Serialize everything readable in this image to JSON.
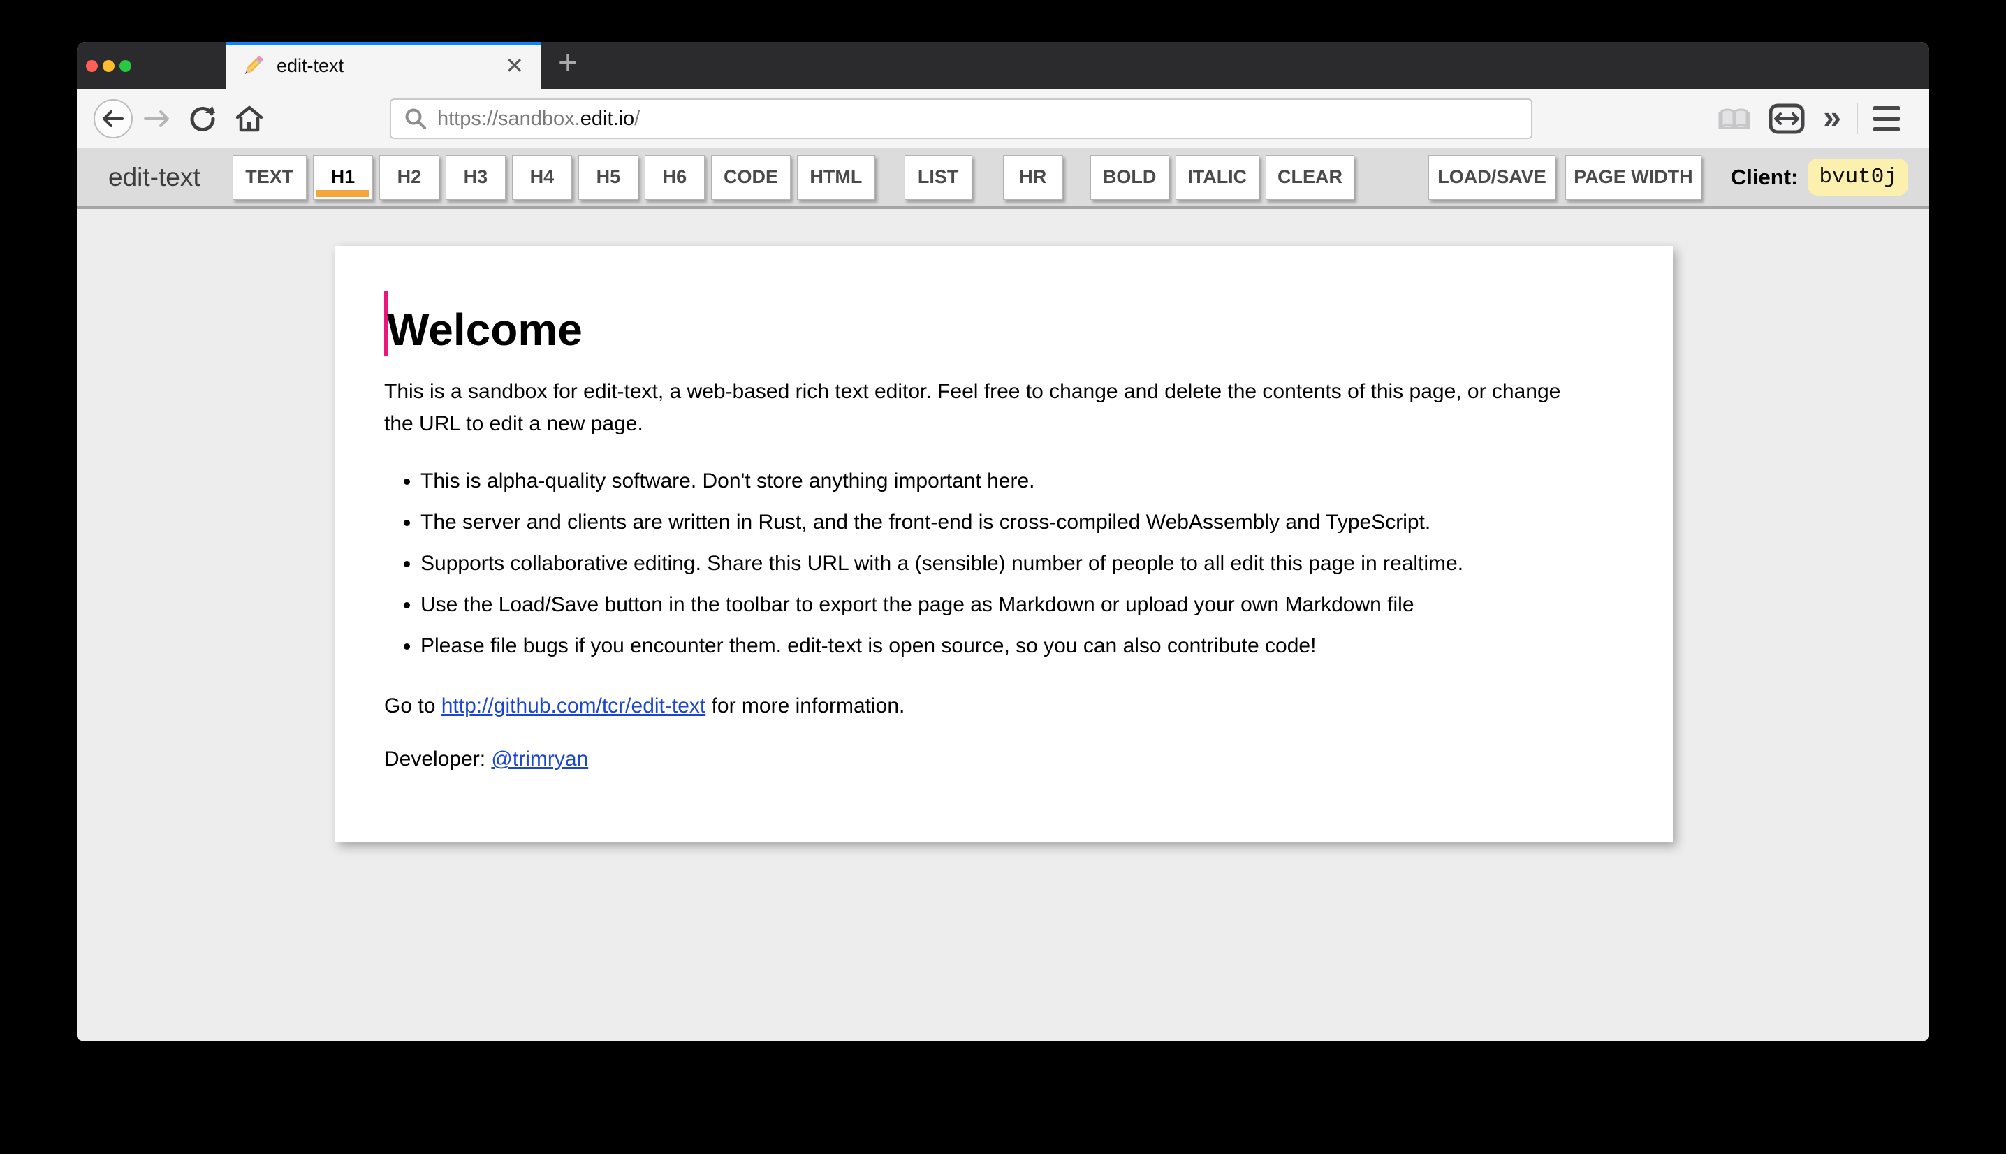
{
  "browser": {
    "tab": {
      "title": "edit-text",
      "close_glyph": "✕"
    },
    "new_tab_glyph": "+",
    "url": {
      "prefix": "https://sandbox.",
      "domain": "edit.io",
      "suffix": "/"
    },
    "overflow_glyph": "»"
  },
  "toolbar": {
    "brand": "edit-text",
    "buttons": [
      {
        "label": "TEXT",
        "active": false
      },
      {
        "label": "H1",
        "active": true
      },
      {
        "label": "H2",
        "active": false
      },
      {
        "label": "H3",
        "active": false
      },
      {
        "label": "H4",
        "active": false
      },
      {
        "label": "H5",
        "active": false
      },
      {
        "label": "H6",
        "active": false
      },
      {
        "label": "CODE",
        "active": false
      },
      {
        "label": "HTML",
        "active": false
      },
      {
        "label": "LIST",
        "active": false
      },
      {
        "label": "HR",
        "active": false
      },
      {
        "label": "BOLD",
        "active": false
      },
      {
        "label": "ITALIC",
        "active": false
      },
      {
        "label": "CLEAR",
        "active": false
      },
      {
        "label": "LOAD/SAVE",
        "active": false
      },
      {
        "label": "PAGE WIDTH",
        "active": false
      }
    ],
    "client_label": "Client:",
    "client_id": "bvut0j"
  },
  "page": {
    "heading": "Welcome",
    "intro": "This is a sandbox for edit-text, a web-based rich text editor. Feel free to change and delete the contents of this page, or change the URL to edit a new page.",
    "bullets": [
      "This is alpha-quality software. Don't store anything important here.",
      "The server and clients are written in Rust, and the front-end is cross-compiled WebAssembly and TypeScript.",
      "Supports collaborative editing. Share this URL with a (sensible) number of people to all edit this page in realtime.",
      "Use the Load/Save button in the toolbar to export the page as Markdown or upload your own Markdown file",
      "Please file bugs if you encounter them. edit-text is open source, so you can also contribute code!"
    ],
    "goto": {
      "before": "Go to ",
      "link": "http://github.com/tcr/edit-text",
      "after": " for more information."
    },
    "developer": {
      "label": "Developer: ",
      "link": "@trimryan"
    }
  },
  "colors": {
    "active_button_underline": "#f5a53d",
    "text_caret": "#ee1480",
    "client_badge_bg": "#fbf0ad",
    "active_tab_stripe": "#0a84ff",
    "link_blue": "#1b46d2"
  }
}
